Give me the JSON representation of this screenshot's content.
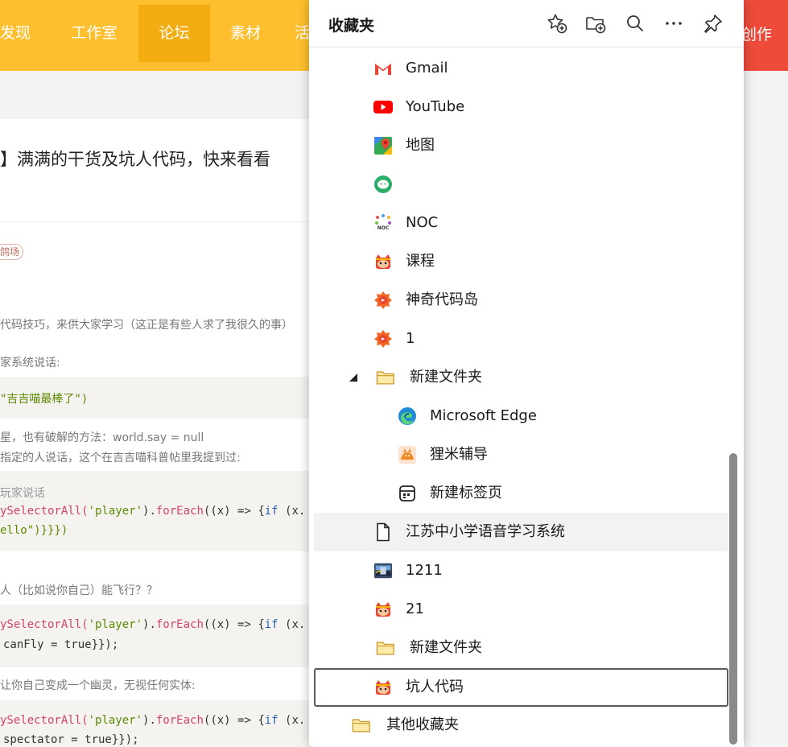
{
  "nav": {
    "items": [
      "发现",
      "工作室",
      "论坛",
      "素材",
      "活"
    ],
    "create": "创作"
  },
  "post": {
    "title": "】满满的干货及坑人代码，快来看看",
    "tag": "鸽场",
    "p1": "代码技巧，来供大家学习（这正是有些人求了我很久的事）",
    "p2": "家系统说话:",
    "code1": "\"吉吉喵最棒了\")",
    "p3": "星，也有破解的方法：world.say = null",
    "p4": "指定的人说话，这个在吉吉喵科普帖里我提到过:",
    "code2_l1": "玩家说话",
    "code2_l2_fn": "ySelectorAll(",
    "code2_l2_str": "'player'",
    "code2_l2_rest": ").",
    "code2_l2_fn2": "forEach",
    "code2_l2_tail": "((x) => {",
    "code2_l2_kw": "if",
    "code2_l2_end": " (x.",
    "code2_l3": "ello\")}}})",
    "p5": "人（比如说你自己）能飞行？？",
    "code3_l1_fn": "ySelectorAll(",
    "code3_l1_str": "'player'",
    "code3_l1_rest": ").",
    "code3_l1_fn2": "forEach",
    "code3_l1_tail": "((x) => {",
    "code3_l1_kw": "if",
    "code3_l1_end": " (x.",
    "code3_l2": "canFly = true}});",
    "p6": "让你自己变成一个幽灵，无视任何实体:",
    "code4_l1_fn": "ySelectorAll(",
    "code4_l1_str": "'player'",
    "code4_l1_rest": ").",
    "code4_l1_fn2": "forEach",
    "code4_l1_tail": "((x) => {",
    "code4_l1_kw": "if",
    "code4_l1_end": " (x.",
    "code4_l2": "spectator = true}});"
  },
  "favorites": {
    "title": "收藏夹",
    "header_icons": [
      "add-favorite-icon",
      "add-folder-icon",
      "search-icon",
      "more-icon",
      "pin-icon"
    ],
    "items": [
      {
        "label": "Gmail",
        "icon": "gmail-icon"
      },
      {
        "label": "YouTube",
        "icon": "youtube-icon"
      },
      {
        "label": "地图",
        "icon": "maps-icon"
      },
      {
        "label": "",
        "icon": "wechat-icon"
      },
      {
        "label": "NOC",
        "icon": "noc-icon"
      },
      {
        "label": "课程",
        "icon": "codemao-icon"
      },
      {
        "label": "神奇代码岛",
        "icon": "code-island-icon"
      },
      {
        "label": "1",
        "icon": "code-island-icon"
      },
      {
        "label": "新建文件夹",
        "icon": "folder-icon",
        "expanded": true
      },
      {
        "label": "Microsoft Edge",
        "icon": "edge-icon"
      },
      {
        "label": "狸米辅导",
        "icon": "limi-icon"
      },
      {
        "label": "新建标签页",
        "icon": "new-tab-icon"
      },
      {
        "label": "江苏中小学语音学习系统",
        "icon": "page-icon"
      },
      {
        "label": "1211",
        "icon": "game-thumb-icon"
      },
      {
        "label": "21",
        "icon": "codemao-icon"
      },
      {
        "label": "新建文件夹",
        "icon": "folder-icon"
      },
      {
        "label": "坑人代码",
        "icon": "codemao-icon"
      },
      {
        "label": "其他收藏夹",
        "icon": "folder-icon"
      }
    ]
  },
  "colors": {
    "nav_bg": "#fdbf2d",
    "nav_active": "#f4ad10",
    "create_bg": "#ee4b3b"
  }
}
